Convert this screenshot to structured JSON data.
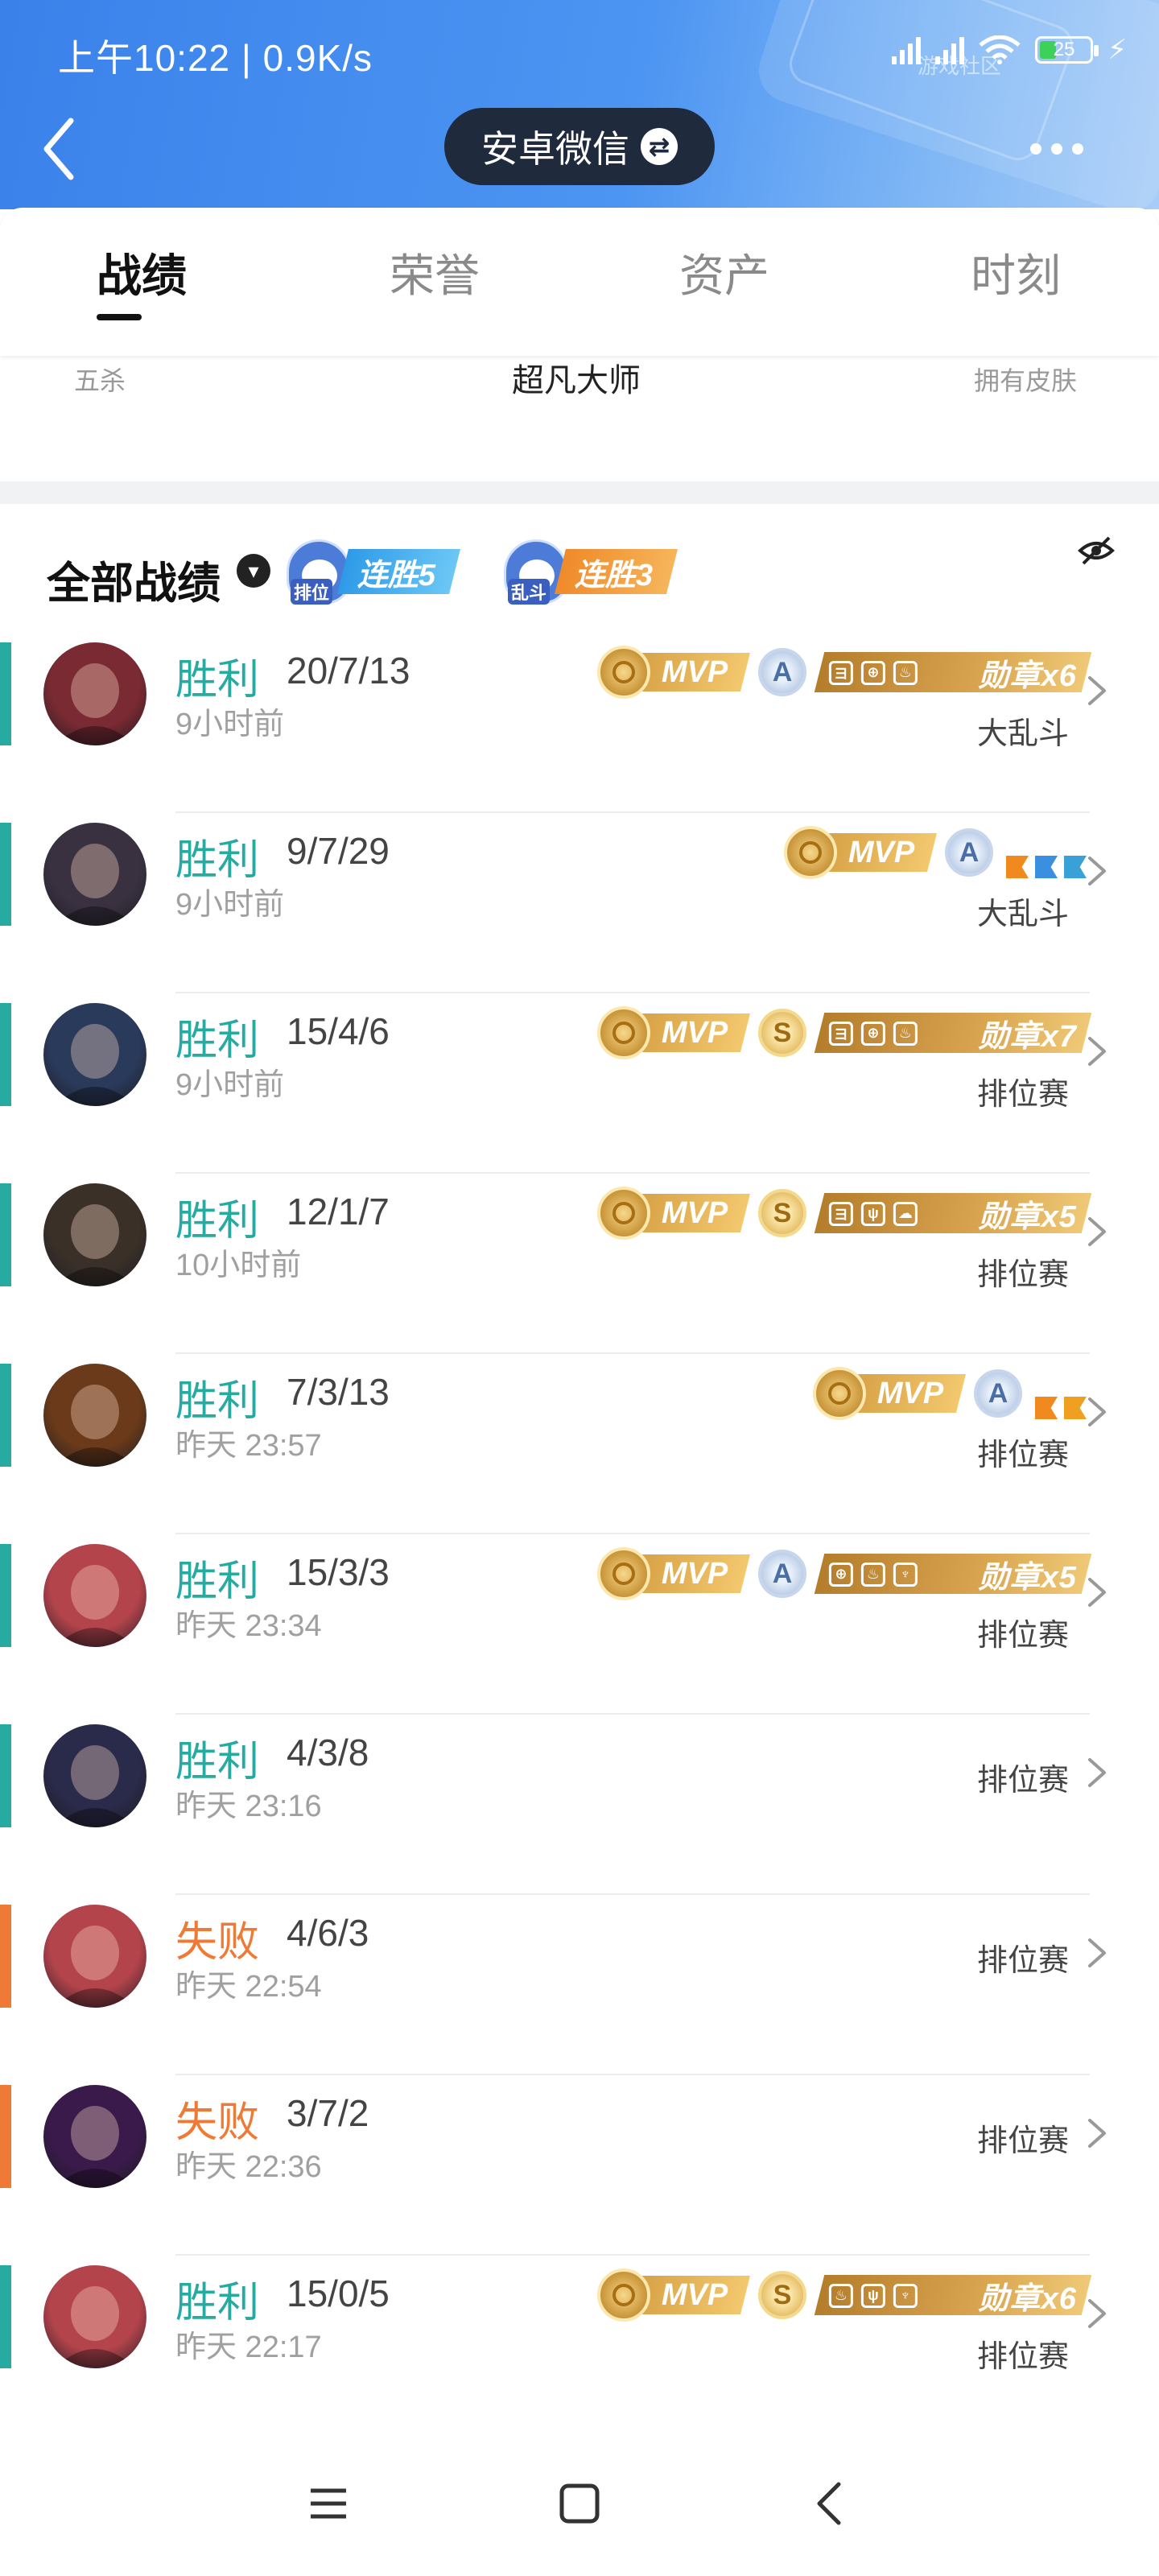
{
  "status_bar": {
    "time": "上午10:22 | 0.9K/s",
    "battery": "25",
    "watermark": "游戏社区"
  },
  "header": {
    "account": "安卓微信",
    "switch_icon": "⇄"
  },
  "tabs": [
    {
      "label": "战绩",
      "active": true
    },
    {
      "label": "荣誉",
      "active": false
    },
    {
      "label": "资产",
      "active": false
    },
    {
      "label": "时刻",
      "active": false
    }
  ],
  "summary": {
    "left": "五杀",
    "center": "超凡大师",
    "right": "拥有皮肤"
  },
  "filter": {
    "title": "全部战绩"
  },
  "streaks": [
    {
      "tag": "排位",
      "label": "连胜5",
      "color": "#3aa8f0"
    },
    {
      "tag": "乱斗",
      "label": "连胜3",
      "color": "#f29a38"
    }
  ],
  "colors": {
    "win": "#27aaa0",
    "loss": "#ef7a35",
    "mvp": "#e0ad55"
  },
  "matches": [
    {
      "result": "胜利",
      "win": true,
      "kda": "20/7/13",
      "time": "9小时前",
      "mode": "大乱斗",
      "mvp": "MVP",
      "grade": "A",
      "medal": "勋章x6",
      "medal_icons": [
        "ヨ",
        "⊕",
        "♨"
      ],
      "avatar_color": "#7a2a32"
    },
    {
      "result": "胜利",
      "win": true,
      "kda": "9/7/29",
      "time": "9小时前",
      "mode": "大乱斗",
      "mvp": "MVP",
      "grade": "A",
      "minis": [
        "#f08a1e",
        "#3a8fe0",
        "#3aa0d8"
      ],
      "avatar_color": "#3a3140"
    },
    {
      "result": "胜利",
      "win": true,
      "kda": "15/4/6",
      "time": "9小时前",
      "mode": "排位赛",
      "mvp": "MVP",
      "grade": "S",
      "medal": "勋章x7",
      "medal_icons": [
        "ヨ",
        "⊕",
        "♨"
      ],
      "avatar_color": "#2a3a5a"
    },
    {
      "result": "胜利",
      "win": true,
      "kda": "12/1/7",
      "time": "10小时前",
      "mode": "排位赛",
      "mvp": "MVP",
      "grade": "S",
      "medal": "勋章x5",
      "medal_icons": [
        "ヨ",
        "ψ",
        "☁"
      ],
      "avatar_color": "#3a3028"
    },
    {
      "result": "胜利",
      "win": true,
      "kda": "7/3/13",
      "time": "昨天 23:57",
      "mode": "排位赛",
      "mvp": "MVP",
      "grade": "A",
      "minis": [
        "#f08a1e",
        "#f0a020"
      ],
      "avatar_color": "#6a3a1a"
    },
    {
      "result": "胜利",
      "win": true,
      "kda": "15/3/3",
      "time": "昨天 23:34",
      "mode": "排位赛",
      "mvp": "MVP",
      "grade": "A",
      "medal": "勋章x5",
      "medal_icons": [
        "⊕",
        "♨",
        "♆"
      ],
      "avatar_color": "#b4444c"
    },
    {
      "result": "胜利",
      "win": true,
      "kda": "4/3/8",
      "time": "昨天 23:16",
      "mode": "排位赛",
      "avatar_color": "#2a2a4a"
    },
    {
      "result": "失败",
      "win": false,
      "kda": "4/6/3",
      "time": "昨天 22:54",
      "mode": "排位赛",
      "avatar_color": "#b4444c"
    },
    {
      "result": "失败",
      "win": false,
      "kda": "3/7/2",
      "time": "昨天 22:36",
      "mode": "排位赛",
      "avatar_color": "#3a1a4a"
    },
    {
      "result": "胜利",
      "win": true,
      "kda": "15/0/5",
      "time": "昨天 22:17",
      "mode": "排位赛",
      "mvp": "MVP",
      "grade": "S",
      "medal": "勋章x6",
      "medal_icons": [
        "♨",
        "ψ",
        "♆"
      ],
      "avatar_color": "#b4444c"
    }
  ]
}
